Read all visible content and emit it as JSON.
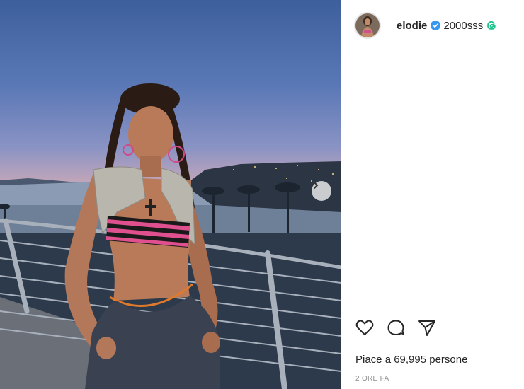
{
  "post": {
    "username": "elodie",
    "song": "2000sss",
    "likes_text": "Piace a 69,995 persone",
    "time_text": "2 ORE FA"
  },
  "icons": {
    "verified": "verified-badge-icon",
    "threads": "threads-icon",
    "like": "heart-icon",
    "comment": "comment-icon",
    "share": "paper-plane-icon",
    "next": "chevron-right-icon"
  },
  "colors": {
    "verified": "#3897f0",
    "threads": "#1ec28b",
    "text": "#262626",
    "muted": "#8e8e8e"
  }
}
